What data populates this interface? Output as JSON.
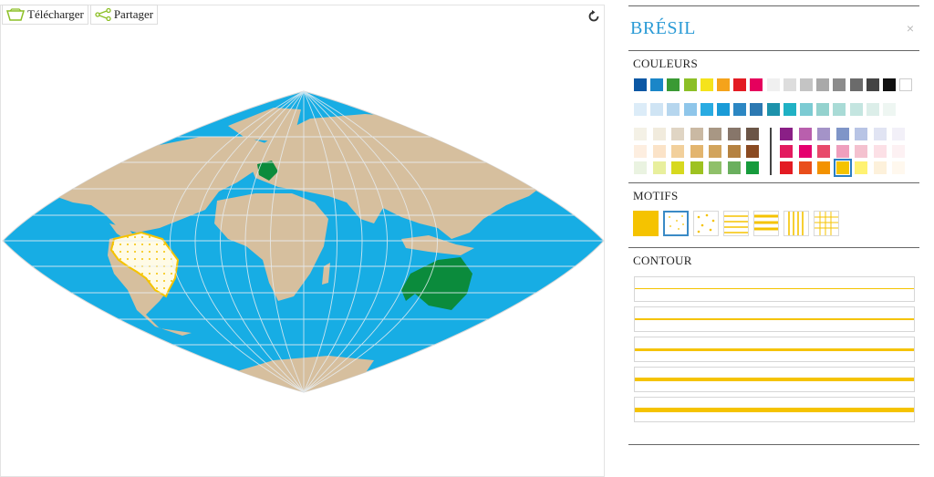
{
  "toolbar": {
    "download_label": "Télécharger",
    "share_label": "Partager"
  },
  "map": {
    "ocean_color": "#17ade4",
    "land_color": "#d6bf9e",
    "selected_country": "Brésil",
    "selected_fill": "#f5c300",
    "highlight_color": "#0b8b3c"
  },
  "panel": {
    "title": "BRÉSIL",
    "close_label": "×",
    "colors_title": "COULEURS",
    "motifs_title": "MOTIFS",
    "contour_title": "CONTOUR"
  },
  "palette": {
    "row1": [
      "#0b57a4",
      "#1a86c8",
      "#3a9a34",
      "#8cbf26",
      "#f5e31b",
      "#f5a31b",
      "#e31b23",
      "#e5005d",
      "#f0f0f0",
      "#dddddd",
      "#c4c4c4",
      "#a9a9a9",
      "#8c8c8c",
      "#6b6b6b",
      "#444444",
      "#111111",
      "#ffffff"
    ],
    "row2": [
      "#dcecf8",
      "#cfe4f4",
      "#b6d6ee",
      "#8fc6ea",
      "#29abe2",
      "#1a9bd7",
      "#2c87c3",
      "#2c79b2",
      "#1d92ab",
      "#20b1c4",
      "#7ccbd3",
      "#94d2ce",
      "#a9dbd6",
      "#c4e5e0",
      "#dceee9",
      "#eef6f2"
    ],
    "left_grid": [
      [
        "#f4f1e6",
        "#f1ebdd",
        "#e0d5c4",
        "#cab9a3",
        "#a89784",
        "#87766a",
        "#6b5547"
      ],
      [
        "#fdeee0",
        "#fbe3c8",
        "#f2d09c",
        "#e3b56e",
        "#d2a45c",
        "#b58241",
        "#8a4a21"
      ],
      [
        "#eaf3e1",
        "#e8ef9d",
        "#d7d91f",
        "#9ec221",
        "#8fc06a",
        "#6aaf5e",
        "#169b3c"
      ]
    ],
    "right_grid": [
      [
        "#8a1f86",
        "#b95fad",
        "#a493c8",
        "#7f95c8",
        "#b8c4e5",
        "#e1e4f3",
        "#f2f0f8"
      ],
      [
        "#e31b5f",
        "#e5006e",
        "#e84a6b",
        "#ef9fbd",
        "#f4c1cf",
        "#fce0e6",
        "#fdf1f3"
      ],
      [
        "#e31b23",
        "#e94e1b",
        "#f39200",
        "#f5c300",
        "#fff271",
        "#fdf1db",
        "#fff8ee"
      ]
    ]
  },
  "motifs": [
    "plein",
    "points",
    "pointillés",
    "lignes horizontales",
    "lignes épaisses",
    "lignes verticales",
    "grille"
  ],
  "contours": [
    "très fin",
    "fin",
    "moyen",
    "épais",
    "très épais"
  ]
}
